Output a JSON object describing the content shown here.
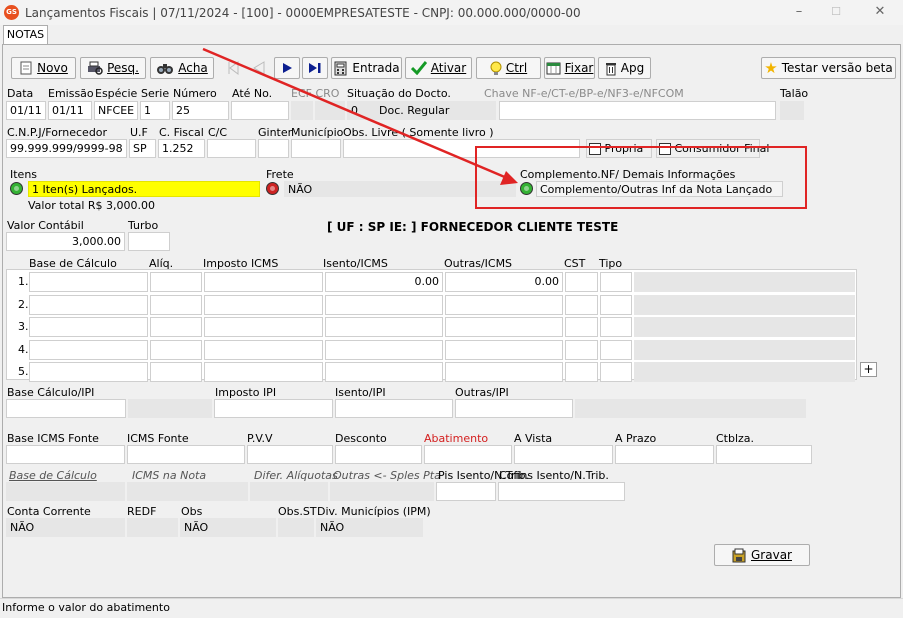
{
  "window": {
    "title": "Lançamentos Fiscais | 07/11/2024 - [100] - 0000EMPRESATESTE - CNPJ: 00.000.000/0000-00",
    "app_icon": "GS",
    "min": "–",
    "max": "☐",
    "close": "✕"
  },
  "tab": {
    "label": "NOTAS"
  },
  "toolbar": {
    "novo": "Novo",
    "pesq": "Pesq.",
    "acha": "Acha",
    "entrada": "Entrada",
    "ativar": "Ativar",
    "ctrl": "Ctrl",
    "fixar": "Fixar",
    "apg": "Apg",
    "testar": "Testar versão beta"
  },
  "row1": {
    "labels": {
      "data": "Data",
      "emissao": "Emissão",
      "especie": "Espécie",
      "serie": "Serie",
      "numero": "Número",
      "ate_no": "Até No.",
      "ecf_cro": "ECF CRO",
      "situacao": "Situação do Docto.",
      "chave": "Chave NF-e/CT-e/BP-e/NF3-e/NFCOM",
      "talao": "Talão"
    },
    "values": {
      "data": "01/11",
      "emissao": "01/11",
      "especie": "NFCEE",
      "serie": "1",
      "numero": "25",
      "situacao_code": "0",
      "situacao_desc": "Doc. Regular"
    }
  },
  "row2": {
    "labels": {
      "cnpj": "C.N.P.J/Fornecedor",
      "uf": "U.F",
      "c_fiscal": "C. Fiscal",
      "cc": "C/C",
      "ginter": "Ginter",
      "municipio": "Município",
      "obs_livre": "Obs. Livre ( Somente livro )"
    },
    "values": {
      "cnpj": "99.999.999/9999-98",
      "uf": "SP",
      "c_fiscal": "1.252"
    },
    "propria": "Propria",
    "consumidor_final": "Consumidor Final"
  },
  "itens": {
    "label": "Itens",
    "value": "1 Iten(s) Lançados.",
    "total": "Valor total R$ 3,000.00"
  },
  "frete": {
    "label": "Frete",
    "value": "NÃO"
  },
  "complemento": {
    "label": "Complemento.NF/ Demais Informações",
    "value": "Complemento/Outras Inf da Nota Lançado"
  },
  "valor_contabil": {
    "label": "Valor Contábil",
    "value": "3,000.00"
  },
  "turbo": {
    "label": "Turbo"
  },
  "fornecedor_banner": "[ UF : SP IE:  ] FORNECEDOR CLIENTE TESTE",
  "icms_table": {
    "headers": [
      "Base de Cálculo",
      "Alíq.",
      "Imposto ICMS",
      "Isento/ICMS",
      "Outras/ICMS",
      "CST",
      "Tipo"
    ],
    "rows": [
      {
        "n": "1.",
        "isento": "0.00",
        "outras": "0.00"
      },
      {
        "n": "2.",
        "isento": "",
        "outras": ""
      },
      {
        "n": "3.",
        "isento": "",
        "outras": ""
      },
      {
        "n": "4.",
        "isento": "",
        "outras": ""
      },
      {
        "n": "5.",
        "isento": "",
        "outras": ""
      }
    ],
    "plus": "+"
  },
  "ipi": {
    "base": "Base Cálculo/IPI",
    "imposto": "Imposto IPI",
    "isento": "Isento/IPI",
    "outras": "Outras/IPI"
  },
  "fonte": {
    "base_icms": "Base ICMS Fonte",
    "icms": "ICMS Fonte",
    "pvv": "P.V.V",
    "desconto": "Desconto",
    "abatimento": "Abatimento",
    "avista": "A Vista",
    "aprazo": "A Prazo",
    "ctblza": "Ctblza."
  },
  "italics": {
    "base_calculo": "Base de Cálculo",
    "icms_nota": "ICMS na Nota",
    "difer": "Difer. Alíquotas",
    "outras": "Outras <- Sples Pta",
    "pis": "Pis Isento/N.Trib.",
    "cofins": "Cofins Isento/N.Trib."
  },
  "bottom": {
    "conta_corrente": "Conta Corrente",
    "conta_corrente_val": "NÃO",
    "redf": "REDF",
    "obs": "Obs",
    "obs_val": "NÃO",
    "obs_st": "Obs.ST",
    "div_municipios": "Div. Municípios (IPM)",
    "div_val": "NÃO"
  },
  "gravar": "Gravar",
  "statusbar": "Informe o valor do abatimento",
  "colors": {
    "highlight": "#ffff00",
    "arrow": "#e02424",
    "radio_green": "#34b234",
    "radio_red": "#cc2222",
    "abatimento": "#d42020"
  }
}
